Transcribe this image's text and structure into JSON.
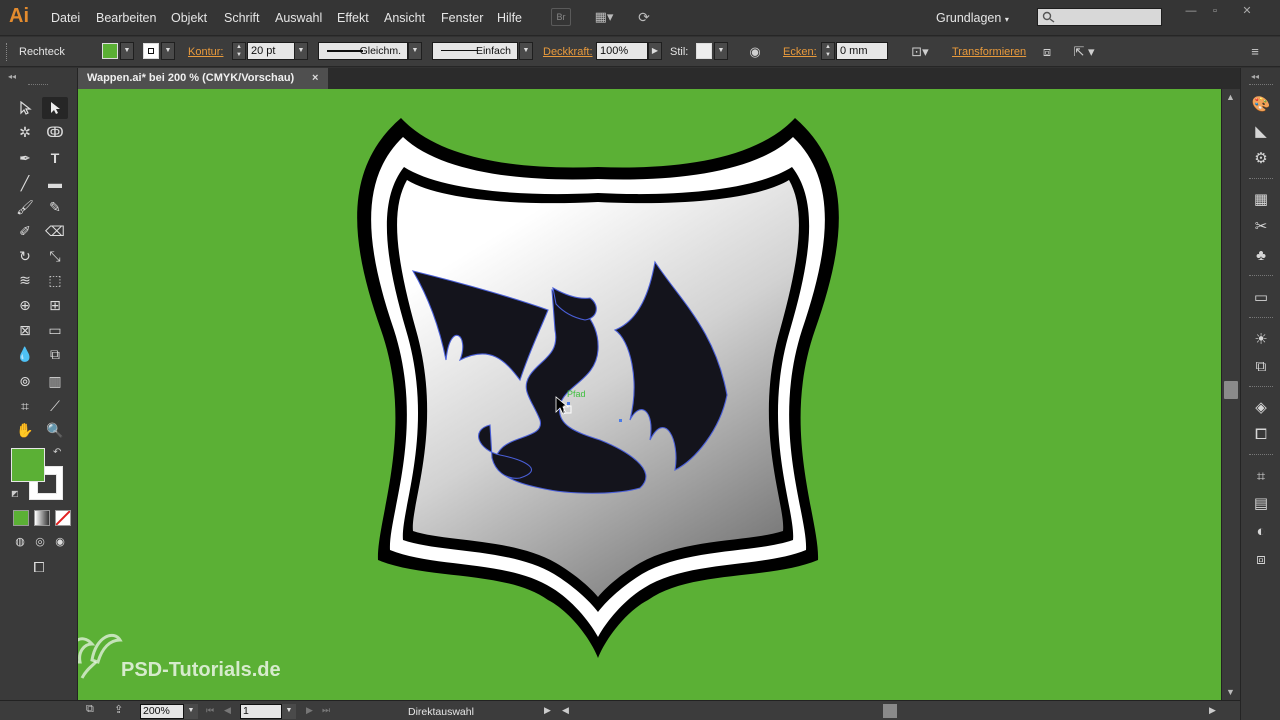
{
  "app": {
    "logo": "Ai",
    "menu": [
      "Datei",
      "Bearbeiten",
      "Objekt",
      "Schrift",
      "Auswahl",
      "Effekt",
      "Ansicht",
      "Fenster",
      "Hilfe"
    ],
    "bridge_label": "Br",
    "workspace": "Grundlagen",
    "search_placeholder": ""
  },
  "controlbar": {
    "object_type": "Rechteck",
    "fill_color": "#5bb035",
    "stroke_label": "Kontur:",
    "stroke_weight": "20 pt",
    "stroke_profile": "Gleichm.",
    "brush_style": "Einfach",
    "opacity_label": "Deckkraft:",
    "opacity_value": "100%",
    "style_label": "Stil:",
    "corners_label": "Ecken:",
    "corners_value": "0 mm",
    "transform_label": "Transformieren"
  },
  "document": {
    "tab_title": "Wappen.ai* bei 200 % (CMYK/Vorschau)",
    "close": "×",
    "canvas_color": "#5bb035",
    "cursor_hint": "Pfad"
  },
  "toolbox": {
    "fill_color": "#5bb035",
    "stroke_color": "#ffffff"
  },
  "statusbar": {
    "zoom": "200%",
    "artboard": "1",
    "current_tool": "Direktauswahl"
  },
  "watermark": {
    "text": "PSD-Tutorials.de"
  }
}
